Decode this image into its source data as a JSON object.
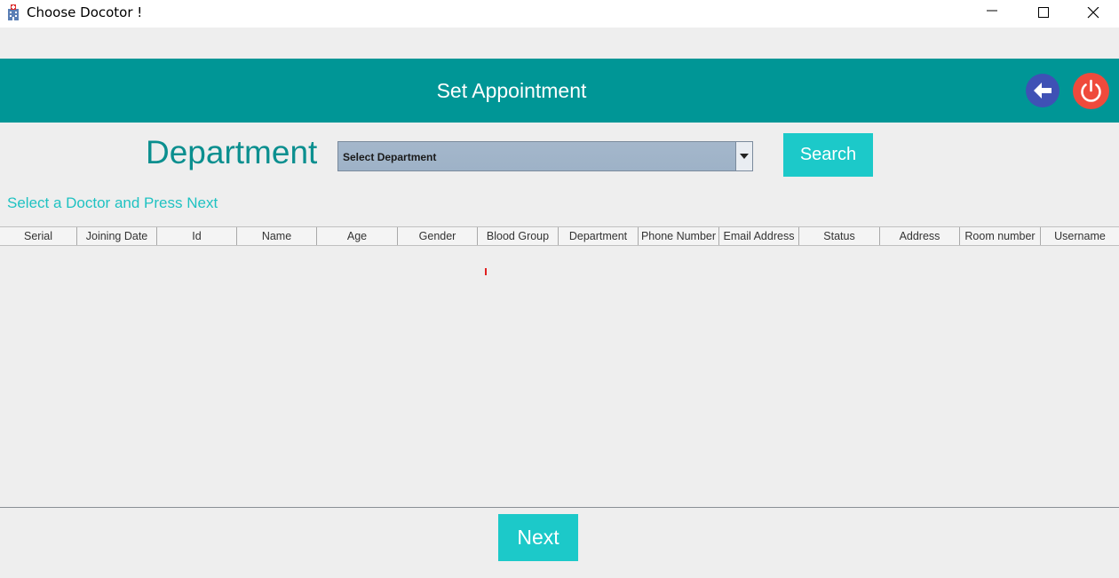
{
  "window": {
    "title": "Choose Docotor !",
    "icons": [
      "hospital-app-icon",
      "minimize-icon",
      "maximize-icon",
      "close-icon"
    ]
  },
  "header": {
    "title": "Set Appointment",
    "background": "#009696",
    "back_icon": "arrow-left-icon",
    "back_color": "#3f51b5",
    "power_icon": "power-icon",
    "power_color": "#ef4a3c"
  },
  "filter": {
    "department_label": "Department",
    "department_select_value": "Select Department",
    "search_label": "Search"
  },
  "hint": "Select a Doctor and Press Next",
  "table": {
    "columns": [
      "Serial",
      "Joining Date",
      "Id",
      "Name",
      "Age",
      "Gender",
      "Blood Group",
      "Department",
      "Phone Number",
      "Email Address",
      "Status",
      "Address",
      "Room number",
      "Username"
    ],
    "rows": []
  },
  "footer": {
    "next_label": "Next"
  },
  "colors": {
    "accent": "#1cc9c9",
    "department_text": "#0b8f8f"
  }
}
